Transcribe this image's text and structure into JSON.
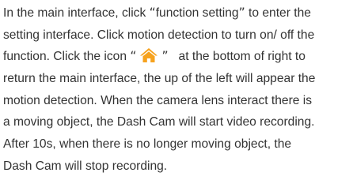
{
  "paragraph": {
    "line1": {
      "before": "In the main interface, click ",
      "open_quote": "“",
      "term": "function setting",
      "close_quote": "”",
      "after": " to enter the"
    },
    "line2": "setting interface. Click motion detection to turn on/ off the",
    "line3": {
      "before": "function. Click the icon ",
      "open_quote": "“",
      "close_quote": "”",
      "after": "   at the bottom of right to"
    },
    "line4": "return the main interface, the up of the left will appear the",
    "line5": "motion detection. When the camera lens interact there is",
    "line6": "a moving object, the Dash Cam will start video recording.",
    "line7": "After 10s, when there is no longer moving object, the",
    "line8": "Dash Cam will stop recording."
  },
  "icons": {
    "home_icon": "home-icon",
    "home_icon_color": "#f6a21e"
  },
  "colors": {
    "text": "#333333",
    "background": "#ffffff"
  }
}
